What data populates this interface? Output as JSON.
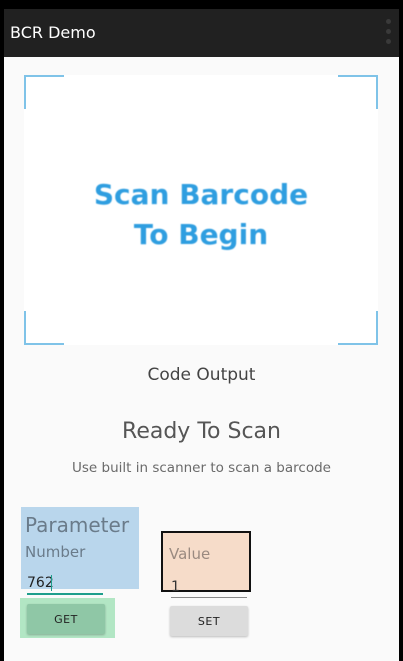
{
  "app": {
    "title": "BCR Demo",
    "menu_icon": "overflow-menu-icon"
  },
  "scanner": {
    "prompt_line1": "Scan Barcode",
    "prompt_line2": "To Begin",
    "label": "Code Output",
    "status": "Ready To Scan",
    "hint": "Use built in scanner to scan a barcode"
  },
  "parameter": {
    "title": "Parameter",
    "field_label": "Number",
    "value": "762"
  },
  "value": {
    "label": "Value",
    "input_value": "1"
  },
  "buttons": {
    "get_label": "GET",
    "set_label": "SET"
  },
  "colors": {
    "appbar": "#212121",
    "scan_text": "#2f9ee0",
    "parameter_bg": "#b9d6ec",
    "value_bg": "#f6dcc9",
    "get_highlight": "#b2e6c4",
    "get_button": "#8fc7a6",
    "set_button": "#dcdcdc",
    "input_accent": "#1e9e8c"
  }
}
